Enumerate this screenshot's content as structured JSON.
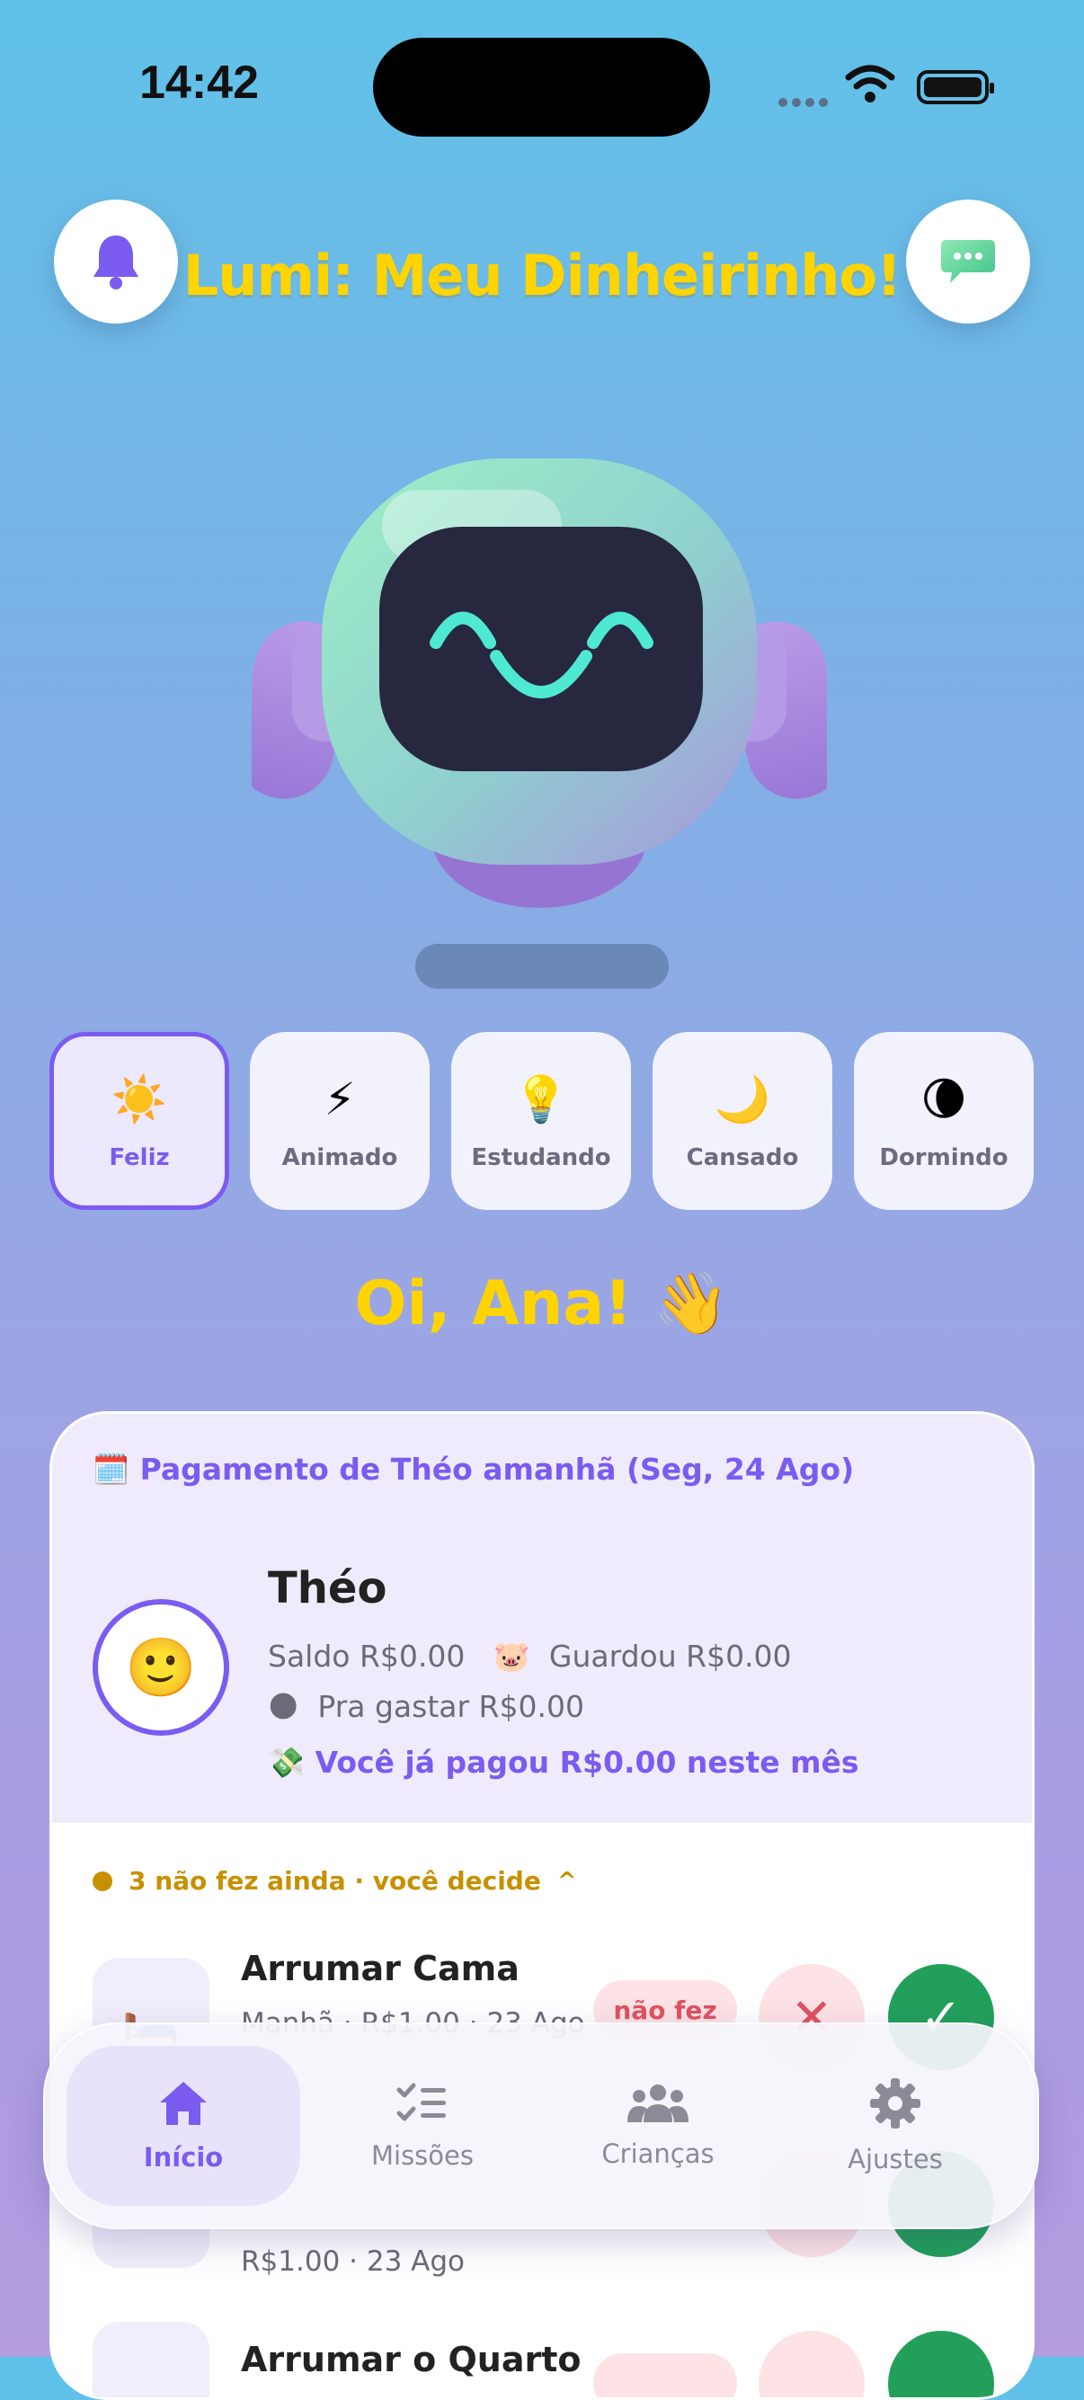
{
  "status_bar": {
    "time": "14:42"
  },
  "header": {
    "title": "Lumi: Meu Dinheirinho!",
    "left_icon": "bell-icon",
    "right_icon": "chat-bubble-icon"
  },
  "moods": [
    {
      "label": "Feliz",
      "icon": "☀️",
      "selected": true
    },
    {
      "label": "Animado",
      "icon": "⚡",
      "selected": false
    },
    {
      "label": "Estudando",
      "icon": "💡",
      "selected": false
    },
    {
      "label": "Cansado",
      "icon": "🌙",
      "selected": false
    },
    {
      "label": "Dormindo",
      "icon": "🌘",
      "selected": false
    }
  ],
  "greeting": "Oi, Ana! 👋",
  "card": {
    "payday_icon": "🗓️",
    "payday": "Pagamento de Théo amanhã (Seg, 24 Ago)",
    "avatar": "🙂",
    "name": "Théo",
    "balance_line": "Saldo R$0.00   🐷  Guardou R$0.00",
    "spend_line": "🌑  Pra gastar R$0.00",
    "paid_line": "💸 Você já pagou R$0.00 neste mês",
    "pending": "3 não fez ainda · você decide",
    "pending_chevron": "^"
  },
  "tasks": [
    {
      "title": "Arrumar Cama",
      "subtitle": "Manhã · R$1.00 · 23 Ago",
      "icon": "🛏️",
      "badge": "não fez"
    },
    {
      "title": "",
      "subtitle": "R$1.00 · 23 Ago",
      "icon": "",
      "badge": ""
    },
    {
      "title": "Arrumar o Quarto",
      "subtitle": "",
      "icon": "",
      "badge": ""
    }
  ],
  "actions": {
    "reject": "✕",
    "approve": "✓"
  },
  "tabbar": [
    {
      "label": "Início",
      "icon": "home-icon",
      "selected": true
    },
    {
      "label": "Missões",
      "icon": "checklist-icon",
      "selected": false
    },
    {
      "label": "Crianças",
      "icon": "people-icon",
      "selected": false
    },
    {
      "label": "Ajustes",
      "icon": "gear-icon",
      "selected": false
    }
  ],
  "colors": {
    "accent": "#7b5bf0",
    "title_yellow": "#ffd400",
    "approve_green": "#22a05a",
    "reject_red": "#e05260",
    "pending_gold": "#c79000"
  }
}
